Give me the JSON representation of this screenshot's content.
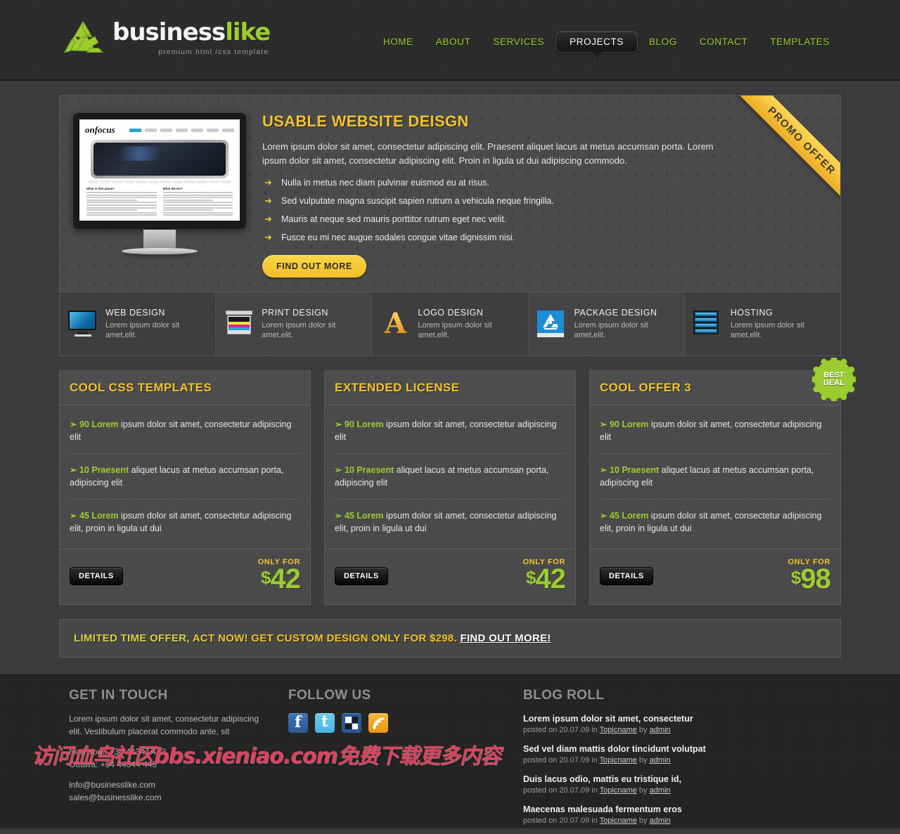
{
  "colors": {
    "page_bg": "#3b3b3b",
    "header_bg": "#2b2b2b",
    "accent_green": "#9ccd30",
    "accent_gold": "#f2c232",
    "footer_bg": "#242424",
    "watermark_red": "#d9455f"
  },
  "header": {
    "brand_part1": "business",
    "brand_part2": "like",
    "brand_tagline": "premium html /css template",
    "logo_icon": "recycle-icon",
    "nav": [
      {
        "label": "HOME",
        "active": false
      },
      {
        "label": "ABOUT",
        "active": false
      },
      {
        "label": "SERVICES",
        "active": false
      },
      {
        "label": "PROJECTS",
        "active": true
      },
      {
        "label": "BLOG",
        "active": false
      },
      {
        "label": "CONTACT",
        "active": false
      },
      {
        "label": "TEMPLATES",
        "active": false
      }
    ]
  },
  "hero": {
    "ribbon": "PROMO OFFER",
    "title": "USABLE WEBSITE DEISGN",
    "paragraph": "Lorem ipsum dolor sit amet, consectetur adipiscing elit. Praesent aliquet lacus at metus accumsan porta. Lorem ipsum dolor sit amet, consectetur adipiscing elit. Proin in ligula ut dui adipiscing commodo.",
    "bullets": [
      "Nulla in metus nec diam pulvinar euismod eu at risus.",
      "Sed vulputate magna suscipit sapien rutrum a vehicula neque fringilla.",
      "Mauris at neque sed mauris porttitor rutrum eget nec velit.",
      "Fusce eu mi nec augue sodales congue vitae dignissim nisi."
    ],
    "cta": "FIND OUT MORE",
    "screenshot": {
      "site_logo": "onfocus",
      "left_heading": "What is this place?",
      "right_heading": "What We Do?"
    }
  },
  "services": [
    {
      "icon": "monitor-icon",
      "title": "WEB DESIGN",
      "desc": "Lorem ipsum dolor sit amet,elit."
    },
    {
      "icon": "printer-icon",
      "title": "PRINT DESIGN",
      "desc": "Lorem ipsum dolor sit amet,elit."
    },
    {
      "icon": "letter-a-icon",
      "title": "LOGO DESIGN",
      "desc": "Lorem ipsum dolor sit amet,elit."
    },
    {
      "icon": "recycle-box-icon",
      "title": "PACKAGE DESIGN",
      "desc": "Lorem ipsum dolor sit amet,elit."
    },
    {
      "icon": "server-rack-icon",
      "title": "HOSTING",
      "desc": "Lorem ipsum dolor sit amet,elit."
    }
  ],
  "pricing": {
    "details_label": "DETAILS",
    "only_for_label": "ONLY FOR",
    "currency": "$",
    "best_deal_badge": "BEST\nDEAL",
    "best_deal_line1": "BEST",
    "best_deal_line2": "DEAL",
    "boxes": [
      {
        "title": "COOL CSS TEMPLATES",
        "price": "42",
        "features": [
          {
            "highlight": "90 Lorem",
            "rest": " ipsum dolor sit amet, consectetur adipiscing elit"
          },
          {
            "highlight": "10 Praesent",
            "rest": " aliquet lacus at metus accumsan porta, adipiscing elit"
          },
          {
            "highlight": "45 Lorem",
            "rest": " ipsum dolor sit amet, consectetur adipiscing elit, proin in ligula ut dui"
          }
        ],
        "badge": false
      },
      {
        "title": "EXTENDED LICENSE",
        "price": "42",
        "features": [
          {
            "highlight": "90 Lorem",
            "rest": " ipsum dolor sit amet, consectetur adipiscing elit"
          },
          {
            "highlight": "10 Praesent",
            "rest": " aliquet lacus at metus accumsan porta, adipiscing elit"
          },
          {
            "highlight": "45 Lorem",
            "rest": " ipsum dolor sit amet, consectetur adipiscing elit, proin in ligula ut dui"
          }
        ],
        "badge": false
      },
      {
        "title": "COOL OFFER 3",
        "price": "98",
        "features": [
          {
            "highlight": "90 Lorem",
            "rest": " ipsum dolor sit amet, consectetur adipiscing elit"
          },
          {
            "highlight": "10 Praesent",
            "rest": " aliquet lacus at metus accumsan porta, adipiscing elit"
          },
          {
            "highlight": "45 Lorem",
            "rest": " ipsum dolor sit amet, consectetur adipiscing elit, proin in ligula ut dui"
          }
        ],
        "badge": true
      }
    ]
  },
  "limited_banner": {
    "part_green": "LIMITED TIME OFFER,",
    "part_gold": " ACT NOW! GET CUSTOM DESIGN ONLY FOR $298. ",
    "link": "FIND OUT MORE!"
  },
  "footer": {
    "get_in_touch": {
      "title": "GET IN TOUCH",
      "paragraph": "Lorem ipsum dolor sit amet, consectetur adipiscing elit. Vestibulum placerat commodo ante, sit",
      "phone_new_york": "New York: +34 44344 443",
      "phone_ottawa": "Ottawa: +34 44344 443",
      "email_info": "info@businesslike.com",
      "email_sales": "sales@businesslike.com"
    },
    "follow_us": {
      "title": "FOLLOW US",
      "icons": [
        "facebook-icon",
        "twitter-icon",
        "delicious-icon",
        "rss-icon"
      ]
    },
    "blog_roll": {
      "title": "BLOG ROLL",
      "posts": [
        {
          "title": "Lorem ipsum dolor sit amet, consectetur",
          "prefix": "posted on 20.07.09 in ",
          "topic": "Topicname",
          "by": " by ",
          "author": "admin"
        },
        {
          "title": "Sed vel diam mattis dolor tincidunt volutpat",
          "prefix": "posted on 20.07.09 in ",
          "topic": "Topicname",
          "by": " by ",
          "author": "admin"
        },
        {
          "title": "Duis lacus odio, mattis eu tristique id,",
          "prefix": "posted on 20.07.09 in ",
          "topic": "Topicname",
          "by": " by ",
          "author": "admin"
        },
        {
          "title": "Maecenas malesuada fermentum eros",
          "prefix": "posted on 20.07.09 in ",
          "topic": "Topicname",
          "by": " by ",
          "author": "admin"
        }
      ]
    }
  },
  "watermark": "访问血鸟社区bbs.xieniao.com免费下载更多内容"
}
